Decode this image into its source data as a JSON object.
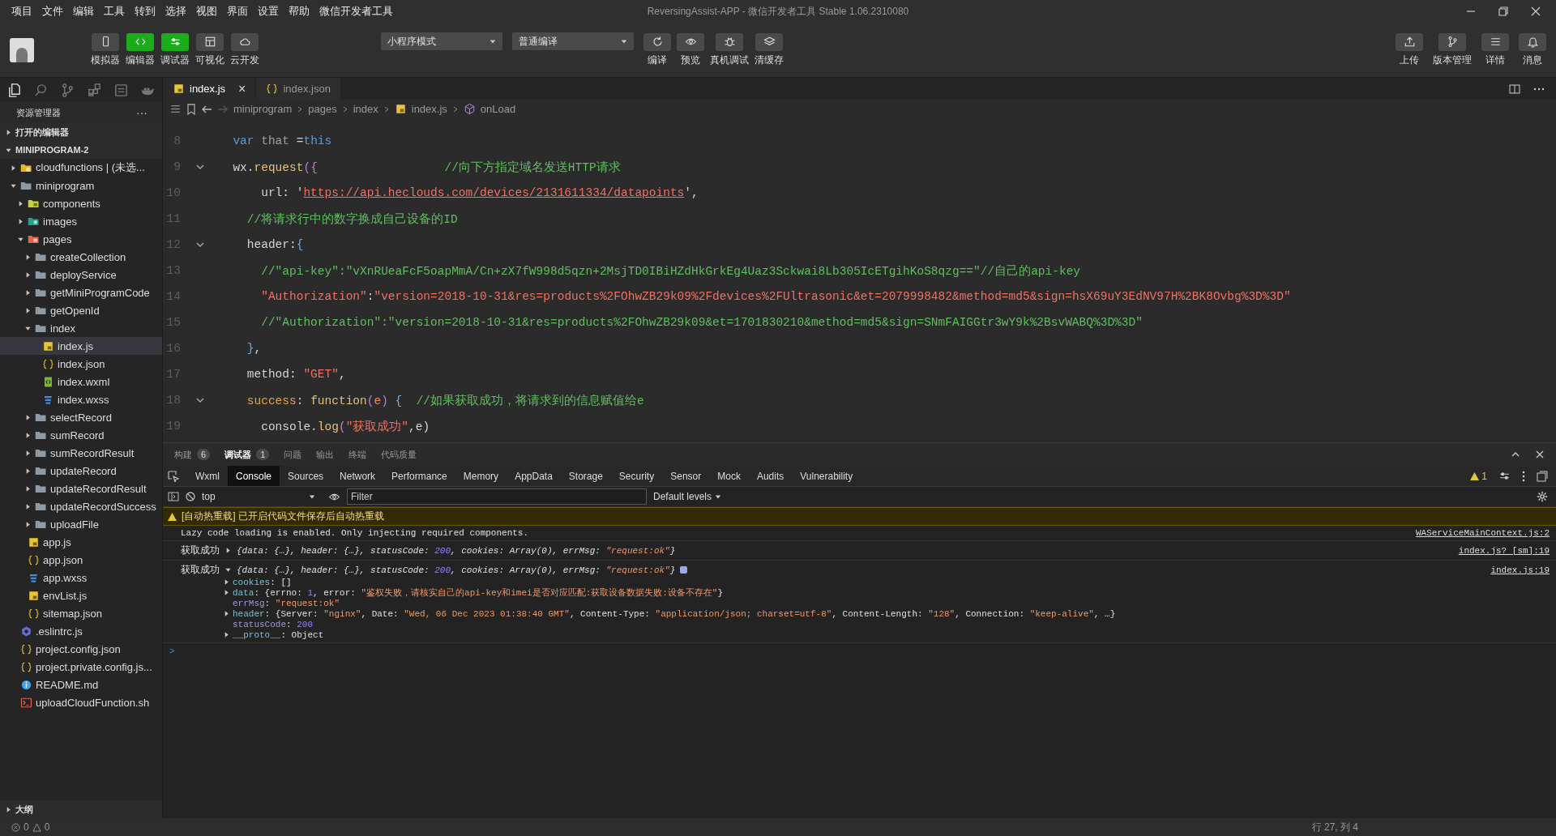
{
  "menu": [
    "项目",
    "文件",
    "编辑",
    "工具",
    "转到",
    "选择",
    "视图",
    "界面",
    "设置",
    "帮助",
    "微信开发者工具"
  ],
  "window": {
    "title": "ReversingAssist-APP - 微信开发者工具 Stable 1.06.2310080"
  },
  "toolbar": {
    "left": [
      {
        "label": "模拟器",
        "kind": "phone",
        "on": false
      },
      {
        "label": "编辑器",
        "kind": "code",
        "on": true
      },
      {
        "label": "调试器",
        "kind": "sliders",
        "on": true
      },
      {
        "label": "可视化",
        "kind": "layout",
        "on": false
      },
      {
        "label": "云开发",
        "kind": "cloud",
        "on": false
      }
    ],
    "mode": "小程序模式",
    "compile_mode": "普通编译",
    "middle": [
      {
        "label": "编译",
        "kind": "refresh"
      },
      {
        "label": "预览",
        "kind": "eye"
      },
      {
        "label": "真机调试",
        "kind": "bug"
      },
      {
        "label": "清缓存",
        "kind": "layers"
      }
    ],
    "right": [
      {
        "label": "上传",
        "kind": "upload"
      },
      {
        "label": "版本管理",
        "kind": "branch"
      },
      {
        "label": "详情",
        "kind": "list"
      },
      {
        "label": "消息",
        "kind": "bell"
      }
    ]
  },
  "activity": [
    {
      "kind": "files",
      "selected": true
    },
    {
      "kind": "search",
      "selected": false
    },
    {
      "kind": "branch",
      "selected": false
    },
    {
      "kind": "grid",
      "selected": false
    },
    {
      "kind": "square",
      "selected": false
    },
    {
      "kind": "whale",
      "selected": false
    }
  ],
  "sidebar": {
    "title": "资源管理器",
    "more": "···",
    "sections": [
      {
        "label": "打开的编辑器",
        "expanded": false
      },
      {
        "label": "MINIPROGRAM-2",
        "expanded": true
      }
    ],
    "tree": [
      {
        "label": "cloudfunctions | (未选...",
        "kind": "folder-cloud",
        "expanded": false,
        "selected": false
      },
      {
        "label": "miniprogram",
        "kind": "folder",
        "expanded": true,
        "selected": false,
        "children": [
          {
            "label": "components",
            "kind": "folder-components",
            "expanded": false,
            "selected": false
          },
          {
            "label": "images",
            "kind": "folder-images",
            "expanded": false,
            "selected": false
          },
          {
            "label": "pages",
            "kind": "folder-pages",
            "expanded": true,
            "selected": false,
            "children": [
              {
                "label": "createCollection",
                "kind": "folder",
                "expanded": false,
                "selected": false
              },
              {
                "label": "deployService",
                "kind": "folder",
                "expanded": false,
                "selected": false
              },
              {
                "label": "getMiniProgramCode",
                "kind": "folder",
                "expanded": false,
                "selected": false
              },
              {
                "label": "getOpenId",
                "kind": "folder",
                "expanded": false,
                "selected": false
              },
              {
                "label": "index",
                "kind": "folder",
                "expanded": true,
                "selected": false,
                "children": [
                  {
                    "label": "index.js",
                    "kind": "js",
                    "selected": true
                  },
                  {
                    "label": "index.json",
                    "kind": "json",
                    "selected": false
                  },
                  {
                    "label": "index.wxml",
                    "kind": "wxml",
                    "selected": false
                  },
                  {
                    "label": "index.wxss",
                    "kind": "wxss",
                    "selected": false
                  }
                ]
              },
              {
                "label": "selectRecord",
                "kind": "folder",
                "expanded": false,
                "selected": false
              },
              {
                "label": "sumRecord",
                "kind": "folder",
                "expanded": false,
                "selected": false
              },
              {
                "label": "sumRecordResult",
                "kind": "folder",
                "expanded": false,
                "selected": false
              },
              {
                "label": "updateRecord",
                "kind": "folder",
                "expanded": false,
                "selected": false
              },
              {
                "label": "updateRecordResult",
                "kind": "folder",
                "expanded": false,
                "selected": false
              },
              {
                "label": "updateRecordSuccess",
                "kind": "folder",
                "expanded": false,
                "selected": false
              },
              {
                "label": "uploadFile",
                "kind": "folder",
                "expanded": false,
                "selected": false
              }
            ]
          },
          {
            "label": "app.js",
            "kind": "js",
            "selected": false
          },
          {
            "label": "app.json",
            "kind": "json",
            "selected": false
          },
          {
            "label": "app.wxss",
            "kind": "wxss",
            "selected": false
          },
          {
            "label": "envList.js",
            "kind": "js",
            "selected": false
          },
          {
            "label": "sitemap.json",
            "kind": "json",
            "selected": false
          }
        ]
      },
      {
        "label": ".eslintrc.js",
        "kind": "eslint",
        "selected": false
      },
      {
        "label": "project.config.json",
        "kind": "json",
        "selected": false
      },
      {
        "label": "project.private.config.js...",
        "kind": "json",
        "selected": false
      },
      {
        "label": "README.md",
        "kind": "info",
        "selected": false
      },
      {
        "label": "uploadCloudFunction.sh",
        "kind": "shell",
        "selected": false
      }
    ],
    "outline": {
      "label": "大纲",
      "expanded": false
    }
  },
  "editor": {
    "tabs": [
      {
        "label": "index.js",
        "kind": "js",
        "selected": true,
        "close": "×"
      },
      {
        "label": "index.json",
        "kind": "json",
        "selected": false
      }
    ],
    "breadcrumb": [
      {
        "label": "miniprogram"
      },
      {
        "label": "pages"
      },
      {
        "label": "index"
      },
      {
        "label": "index.js",
        "kind": "js"
      },
      {
        "label": "onLoad",
        "kind": "method"
      }
    ],
    "lines": [
      {
        "number": "8",
        "fold": false,
        "tokens": [
          {
            "t": "  var",
            "kind": "kw"
          },
          {
            "t": " that ",
            "kind": "var"
          },
          {
            "t": "=",
            "kind": "plain"
          },
          {
            "t": "this",
            "kind": "kw"
          }
        ]
      },
      {
        "number": "9",
        "fold": true,
        "tokens": [
          {
            "t": "  wx.",
            "kind": "plain"
          },
          {
            "t": "request",
            "kind": "fn"
          },
          {
            "t": "({",
            "kind": "punct"
          },
          {
            "t": "                  //向下方指定域名发送HTTP请求",
            "kind": "cmt"
          }
        ]
      },
      {
        "number": "10",
        "fold": false,
        "tokens": [
          {
            "t": "      url: '",
            "kind": "plain"
          },
          {
            "t": "https://api.heclouds.com/devices/2131611334/datapoints",
            "kind": "link"
          },
          {
            "t": "',",
            "kind": "plain"
          }
        ]
      },
      {
        "number": "11",
        "fold": false,
        "tokens": [
          {
            "t": "    //将请求行中的数字换成自己设备的ID",
            "kind": "cmt"
          }
        ]
      },
      {
        "number": "12",
        "fold": true,
        "tokens": [
          {
            "t": "    header:",
            "kind": "plain"
          },
          {
            "t": "{",
            "kind": "brace"
          }
        ]
      },
      {
        "number": "13",
        "fold": false,
        "tokens": [
          {
            "t": "      //\"api-key\":\"vXnRUeaFcF5oapMmA/Cn+zX7fW998d5qzn+2MsjTD0IBiHZdHkGrkEg4Uaz3Sckwai8Lb305IcETgihKoS8qzg==\"//自己的api-key",
            "kind": "cmt"
          }
        ]
      },
      {
        "number": "14",
        "fold": false,
        "tokens": [
          {
            "t": "      \"Authorization\"",
            "kind": "str"
          },
          {
            "t": ":",
            "kind": "plain"
          },
          {
            "t": "\"version=2018-10-31&res=products%2FOhwZB29k09%2Fdevices%2FUltrasonic&et=2079998482&method=md5&sign=hsX69uY3EdNV97H%2BK8Ovbg%3D%3D\"",
            "kind": "str"
          }
        ]
      },
      {
        "number": "15",
        "fold": false,
        "tokens": [
          {
            "t": "      //\"Authorization\":\"version=2018-10-31&res=products%2FOhwZB29k09&et=1701830210&method=md5&sign=SNmFAIGGtr3wY9k%2BsvWABQ%3D%3D\"",
            "kind": "cmt"
          }
        ]
      },
      {
        "number": "16",
        "fold": false,
        "tokens": [
          {
            "t": "    }",
            "kind": "brace"
          },
          {
            "t": ",",
            "kind": "plain"
          }
        ]
      },
      {
        "number": "17",
        "fold": false,
        "tokens": [
          {
            "t": "    method: ",
            "kind": "plain"
          },
          {
            "t": "\"GET\"",
            "kind": "str"
          },
          {
            "t": ",",
            "kind": "plain"
          }
        ]
      },
      {
        "number": "18",
        "fold": true,
        "tokens": [
          {
            "t": "    success",
            "kind": "prop"
          },
          {
            "t": ": ",
            "kind": "plain"
          },
          {
            "t": "function",
            "kind": "fn"
          },
          {
            "t": "(",
            "kind": "punct"
          },
          {
            "t": "e",
            "kind": "param"
          },
          {
            "t": ")",
            "kind": "punct"
          },
          {
            "t": " {",
            "kind": "brace"
          },
          {
            "t": "  //如果获取成功，将请求到的信息赋值给e",
            "kind": "cmt"
          }
        ]
      },
      {
        "number": "19",
        "fold": false,
        "tokens": [
          {
            "t": "      console.",
            "kind": "plain"
          },
          {
            "t": "log",
            "kind": "fn"
          },
          {
            "t": "(",
            "kind": "punct"
          },
          {
            "t": "\"获取成功\"",
            "kind": "str"
          },
          {
            "t": ",e)",
            "kind": "plain"
          }
        ]
      }
    ]
  },
  "panel": {
    "tabs": [
      {
        "label": "构建",
        "count": "6",
        "selected": false
      },
      {
        "label": "调试器",
        "count": "1",
        "selected": true
      },
      {
        "label": "问题",
        "selected": false
      },
      {
        "label": "输出",
        "selected": false
      },
      {
        "label": "终端",
        "selected": false
      },
      {
        "label": "代码质量",
        "selected": false
      }
    ],
    "devtools_tabs": [
      {
        "label": "Wxml",
        "selected": false
      },
      {
        "label": "Console",
        "selected": true
      },
      {
        "label": "Sources",
        "selected": false
      },
      {
        "label": "Network",
        "selected": false
      },
      {
        "label": "Performance",
        "selected": false
      },
      {
        "label": "Memory",
        "selected": false
      },
      {
        "label": "AppData",
        "selected": false
      },
      {
        "label": "Storage",
        "selected": false
      },
      {
        "label": "Security",
        "selected": false
      },
      {
        "label": "Sensor",
        "selected": false
      },
      {
        "label": "Mock",
        "selected": false
      },
      {
        "label": "Audits",
        "selected": false
      },
      {
        "label": "Vulnerability",
        "selected": false
      }
    ],
    "warnings": "1",
    "context": "top",
    "filter": {
      "placeholder": "Filter"
    },
    "levels": "Default levels",
    "console": [
      {
        "kind": "warn",
        "text": "[自动热重载] 已开启代码文件保存后自动热重载"
      },
      {
        "kind": "info",
        "text": "Lazy code loading is enabled. Only injecting required components.",
        "source": "WAServiceMainContext.js:2"
      },
      {
        "kind": "log",
        "label": "获取成功",
        "expanded": false,
        "source": "index.js? [sm]:19",
        "summary": [
          {
            "t": "{data: {…}, header: {…}, statusCode: ",
            "kind": "plain"
          },
          {
            "t": "200",
            "kind": "num"
          },
          {
            "t": ", cookies: Array(0), errMsg: ",
            "kind": "plain"
          },
          {
            "t": "\"request:ok\"",
            "kind": "str"
          },
          {
            "t": "}",
            "kind": "plain"
          }
        ]
      },
      {
        "kind": "log",
        "label": "获取成功",
        "expanded": true,
        "source": "index.js:19",
        "summary": [
          {
            "t": "{data: {…}, header: {…}, statusCode: ",
            "kind": "plain"
          },
          {
            "t": "200",
            "kind": "num"
          },
          {
            "t": ", cookies: Array(0), errMsg: ",
            "kind": "plain"
          },
          {
            "t": "\"request:ok\"",
            "kind": "str"
          },
          {
            "t": "}",
            "kind": "plain"
          }
        ],
        "children": [
          {
            "key": "cookies",
            "expandable": true,
            "value": [
              {
                "t": ": []",
                "kind": "plain"
              }
            ]
          },
          {
            "key": "data",
            "expandable": true,
            "value": [
              {
                "t": ": {errno: ",
                "kind": "plain"
              },
              {
                "t": "1",
                "kind": "num"
              },
              {
                "t": ", error: ",
                "kind": "plain"
              },
              {
                "t": "\"鉴权失败，请核实自己的api-key和imei是否对应匹配:获取设备数据失败:设备不存在\"",
                "kind": "str"
              },
              {
                "t": "}",
                "kind": "plain"
              }
            ]
          },
          {
            "key": "errMsg",
            "expandable": false,
            "value": [
              {
                "t": ": ",
                "kind": "plain"
              },
              {
                "t": "\"request:ok\"",
                "kind": "str"
              }
            ]
          },
          {
            "key": "header",
            "expandable": true,
            "value": [
              {
                "t": ": {Server: ",
                "kind": "plain"
              },
              {
                "t": "\"nginx\"",
                "kind": "str"
              },
              {
                "t": ", Date: ",
                "kind": "plain"
              },
              {
                "t": "\"Wed, 06 Dec 2023 01:38:40 GMT\"",
                "kind": "str"
              },
              {
                "t": ", Content-Type: ",
                "kind": "plain"
              },
              {
                "t": "\"application/json; charset=utf-8\"",
                "kind": "str"
              },
              {
                "t": ", Content-Length: ",
                "kind": "plain"
              },
              {
                "t": "\"128\"",
                "kind": "str"
              },
              {
                "t": ", Connection: ",
                "kind": "plain"
              },
              {
                "t": "\"keep-alive\"",
                "kind": "str"
              },
              {
                "t": ", …}",
                "kind": "plain"
              }
            ]
          },
          {
            "key": "statusCode",
            "expandable": false,
            "value": [
              {
                "t": ": ",
                "kind": "plain"
              },
              {
                "t": "200",
                "kind": "num"
              }
            ]
          },
          {
            "key": "__proto__",
            "expandable": true,
            "value": [
              {
                "t": ": Object",
                "kind": "plain"
              }
            ]
          }
        ]
      },
      {
        "kind": "prompt",
        "text": ">"
      }
    ]
  },
  "status_bar": {
    "errors": "0",
    "warnings": "0",
    "position": "行 27, 列 4"
  }
}
